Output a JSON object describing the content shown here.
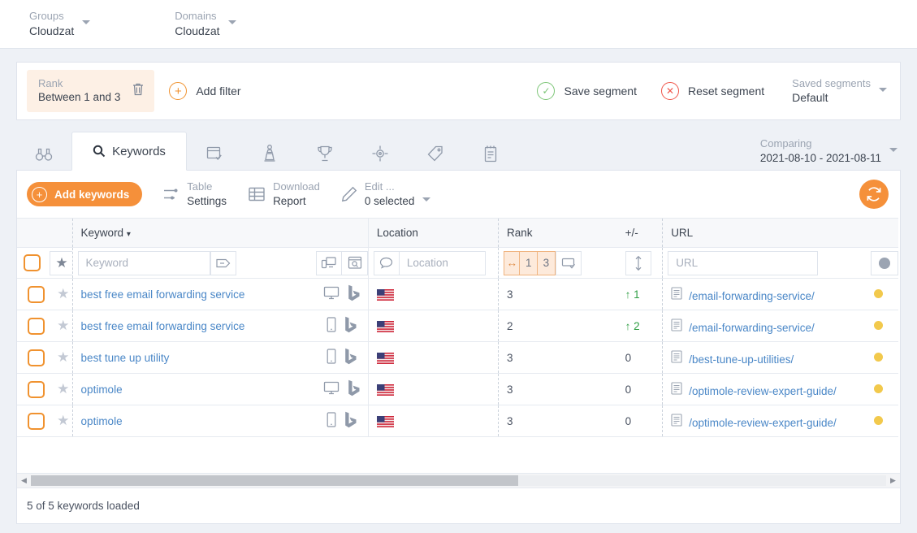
{
  "topbar": {
    "selectors": [
      {
        "label": "Groups",
        "value": "Cloudzat"
      },
      {
        "label": "Domains",
        "value": "Cloudzat"
      }
    ]
  },
  "filterbar": {
    "chip": {
      "label": "Rank",
      "value": "Between 1 and 3",
      "delete_icon": "trash-icon"
    },
    "add_filter": "Add filter",
    "save_segment": "Save segment",
    "reset_segment": "Reset segment",
    "saved_segments": {
      "label": "Saved segments",
      "value": "Default"
    }
  },
  "tabs": {
    "items": [
      {
        "icon": "binoculars-icon",
        "label": "",
        "active": false
      },
      {
        "icon": "search-icon",
        "label": "Keywords",
        "active": true
      },
      {
        "icon": "window-check-icon",
        "label": "",
        "active": false
      },
      {
        "icon": "chess-pawn-icon",
        "label": "",
        "active": false
      },
      {
        "icon": "trophy-icon",
        "label": "",
        "active": false
      },
      {
        "icon": "crosshair-icon",
        "label": "",
        "active": false
      },
      {
        "icon": "tag-icon",
        "label": "",
        "active": false
      },
      {
        "icon": "clipboard-icon",
        "label": "",
        "active": false
      }
    ],
    "comparing": {
      "label": "Comparing",
      "value": "2021-08-10 - 2021-08-11"
    }
  },
  "toolbar": {
    "add_keywords": "Add keywords",
    "table_settings": {
      "l1": "Table",
      "l2": "Settings"
    },
    "download_report": {
      "l1": "Download",
      "l2": "Report"
    },
    "edit": {
      "l1": "Edit ...",
      "l2": "0 selected"
    },
    "refresh_icon": "refresh-icon"
  },
  "table": {
    "headers": {
      "keyword": "Keyword",
      "location": "Location",
      "rank": "Rank",
      "delta": "+/-",
      "url": "URL"
    },
    "filters": {
      "keyword_placeholder": "Keyword",
      "location_placeholder": "Location",
      "url_placeholder": "URL",
      "rank_from": "1",
      "rank_to": "3"
    },
    "rows": [
      {
        "keyword": "best free email forwarding service",
        "device": "desktop",
        "engine": "bing",
        "country": "US",
        "location": "",
        "rank": "3",
        "delta": "1",
        "delta_dir": "up",
        "url": "/email-forwarding-service/",
        "status": "amber"
      },
      {
        "keyword": "best free email forwarding service",
        "device": "mobile",
        "engine": "bing",
        "country": "US",
        "location": "",
        "rank": "2",
        "delta": "2",
        "delta_dir": "up",
        "url": "/email-forwarding-service/",
        "status": "amber"
      },
      {
        "keyword": "best tune up utility",
        "device": "mobile",
        "engine": "bing",
        "country": "US",
        "location": "",
        "rank": "3",
        "delta": "0",
        "delta_dir": "flat",
        "url": "/best-tune-up-utilities/",
        "status": "amber"
      },
      {
        "keyword": "optimole",
        "device": "desktop",
        "engine": "bing",
        "country": "US",
        "location": "",
        "rank": "3",
        "delta": "0",
        "delta_dir": "flat",
        "url": "/optimole-review-expert-guide/",
        "status": "amber"
      },
      {
        "keyword": "optimole",
        "device": "mobile",
        "engine": "bing",
        "country": "US",
        "location": "",
        "rank": "3",
        "delta": "0",
        "delta_dir": "flat",
        "url": "/optimole-review-expert-guide/",
        "status": "amber"
      }
    ]
  },
  "footer": {
    "status": "5 of 5 keywords loaded"
  },
  "colors": {
    "accent_orange": "#f5903a",
    "link_blue": "#4a87c7",
    "green": "#2f9e44",
    "amber": "#f2c94c",
    "page_bg": "#eef1f6"
  }
}
